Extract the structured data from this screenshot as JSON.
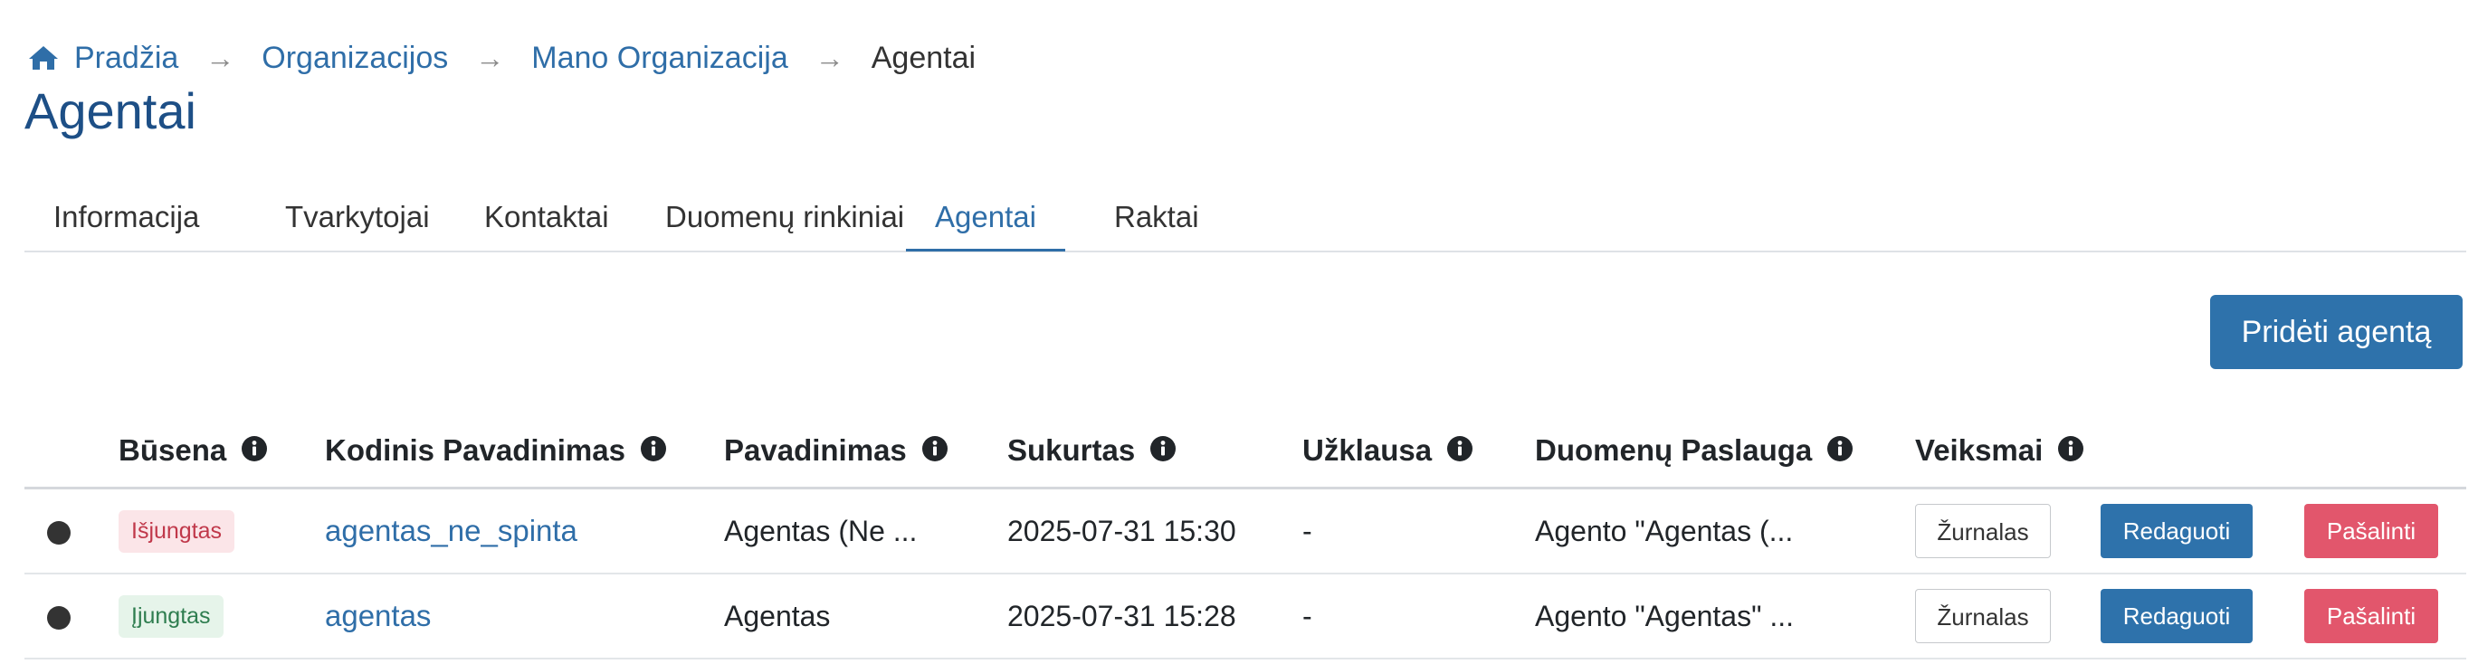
{
  "breadcrumb": {
    "home_icon": "home-icon",
    "items": [
      "Pradžia",
      "Organizacijos",
      "Mano Organizacija"
    ],
    "separator": "→",
    "current": "Agentai"
  },
  "page_title": "Agentai",
  "tabs": [
    {
      "label": "Informacija",
      "active": false
    },
    {
      "label": "Tvarkytojai",
      "active": false
    },
    {
      "label": "Kontaktai",
      "active": false
    },
    {
      "label": "Duomenų rinkiniai",
      "active": false
    },
    {
      "label": "Agentai",
      "active": true
    },
    {
      "label": "Raktai",
      "active": false
    }
  ],
  "add_button": "Pridėti agentą",
  "table": {
    "headers": [
      "Būsena",
      "Kodinis Pavadinimas",
      "Pavadinimas",
      "Sukurtas",
      "Užklausa",
      "Duomenų Paslauga",
      "Veiksmai"
    ],
    "info_icon": "info-circle-icon",
    "rows": [
      {
        "status": "Išjungtas",
        "status_kind": "disabled",
        "code_name": "agentas_ne_spinta",
        "name": "Agentas (Ne ...",
        "created": "2025-07-31 15:30",
        "request": "-",
        "service": "Agento \"Agentas (...",
        "actions": {
          "log": "Žurnalas",
          "edit": "Redaguoti",
          "delete": "Pašalinti"
        }
      },
      {
        "status": "Įjungtas",
        "status_kind": "enabled",
        "code_name": "agentas",
        "name": "Agentas",
        "created": "2025-07-31 15:28",
        "request": "-",
        "service": "Agento \"Agentas\" ...",
        "actions": {
          "log": "Žurnalas",
          "edit": "Redaguoti",
          "delete": "Pašalinti"
        }
      }
    ]
  },
  "colors": {
    "primary": "#2e72ab",
    "danger": "#e2566c",
    "link": "#2f6ea8",
    "title": "#1d4f86"
  }
}
